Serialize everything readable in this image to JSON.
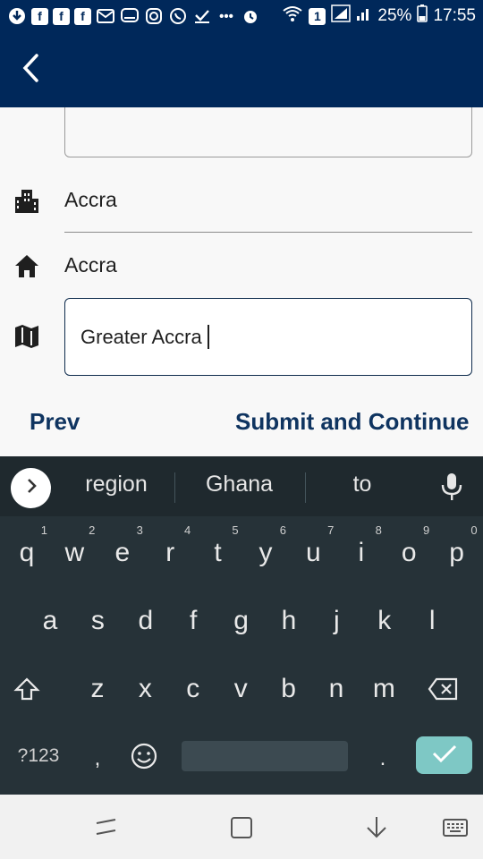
{
  "status_bar": {
    "battery_percent": "25%",
    "time": "17:55",
    "sim_badge": "1",
    "icons": [
      "download-icon",
      "facebook-icon",
      "facebook-icon",
      "facebook-icon",
      "mail-icon",
      "message-icon",
      "instagram-icon",
      "whatsapp-icon",
      "check-icon",
      "more-icon",
      "alarm-icon",
      "wifi-icon",
      "signal-icon",
      "signal-icon",
      "battery-icon"
    ]
  },
  "app_bar": {
    "back_icon": "back-arrow-icon"
  },
  "form": {
    "city_icon": "city-icon",
    "city_value": "Accra",
    "town_icon": "home-icon",
    "town_value": "Accra",
    "region_icon": "map-icon",
    "region_value": "Greater Accra",
    "prev_label": "Prev",
    "submit_label": "Submit and Continue"
  },
  "keyboard": {
    "suggestions": [
      "region",
      "Ghana",
      "to"
    ],
    "row1": [
      "q",
      "w",
      "e",
      "r",
      "t",
      "y",
      "u",
      "i",
      "o",
      "p"
    ],
    "row1_hints": [
      "1",
      "2",
      "3",
      "4",
      "5",
      "6",
      "7",
      "8",
      "9",
      "0"
    ],
    "row2": [
      "a",
      "s",
      "d",
      "f",
      "g",
      "h",
      "j",
      "k",
      "l"
    ],
    "row3": [
      "z",
      "x",
      "c",
      "v",
      "b",
      "n",
      "m"
    ],
    "symbols_label": "?123",
    "comma_label": ",",
    "period_label": ".",
    "colors": {
      "background": "#263238",
      "enter": "#7ec8c5",
      "app_bar": "#00285a"
    }
  },
  "nav_bar": {
    "icons": [
      "recents-icon",
      "home-icon",
      "back-icon",
      "keyboard-switch-icon"
    ]
  }
}
